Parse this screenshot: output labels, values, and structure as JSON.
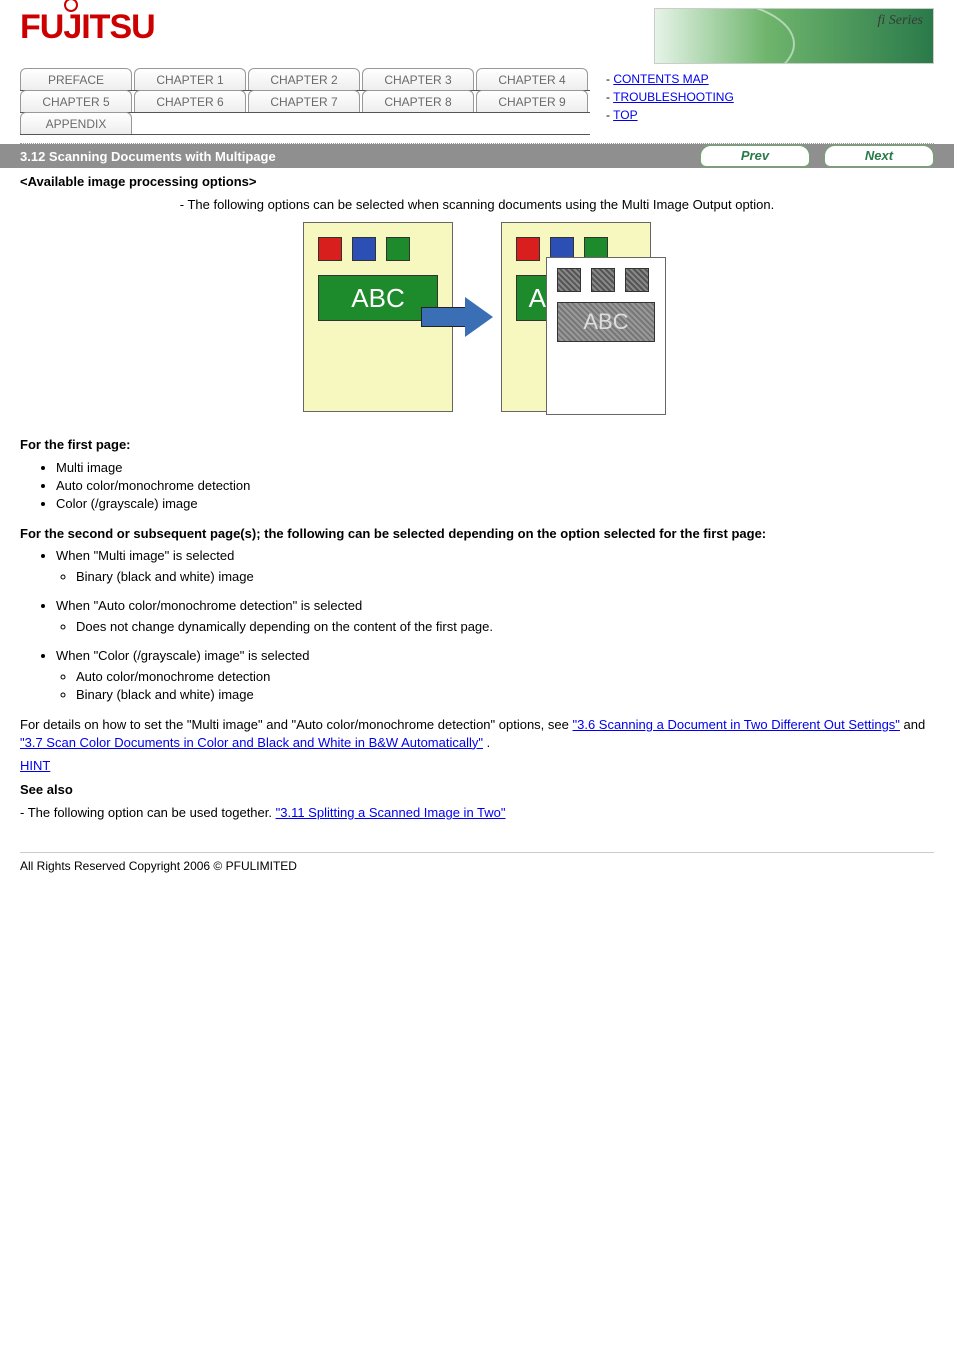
{
  "header": {
    "logo_alt": "FUJITSU",
    "banner_label": "fi Series"
  },
  "nav": {
    "rows": [
      [
        "PREFACE",
        "CHAPTER 1",
        "CHAPTER 2",
        "CHAPTER 3",
        "CHAPTER 4"
      ],
      [
        "CHAPTER 5",
        "CHAPTER 6",
        "CHAPTER 7",
        "CHAPTER 8",
        "CHAPTER 9"
      ],
      [
        "APPENDIX"
      ]
    ],
    "side_links": [
      "CONTENTS MAP",
      "TROUBLESHOOTING",
      "TOP"
    ]
  },
  "greybar": {
    "section_title": "3.12 Scanning Documents with Multipage",
    "prev_label": "Prev",
    "next_label": "Next"
  },
  "content": {
    "subtitle": "<Available image processing options>",
    "figure_caption": "- The following options can be selected when scanning documents using the Multi Image Output option.",
    "abc_label": "ABC",
    "first_group_title": "For the first page:",
    "first_group_items": [
      "Multi image",
      "Auto color/monochrome detection",
      "Color (/grayscale) image"
    ],
    "second_group_title": "For the second or subsequent page(s); the following can be selected depending on the option selected for the first page:",
    "second_group": [
      {
        "when": "When \"Multi image\" is selected",
        "items": [
          "Binary (black and white) image"
        ]
      },
      {
        "when": "When \"Auto color/monochrome detection\" is selected",
        "items": [
          "Does not change dynamically depending on the content of the first page."
        ]
      },
      {
        "when": "When \"Color (/grayscale) image\" is selected",
        "items": [
          "Auto color/monochrome detection",
          "Binary (black and white) image"
        ]
      }
    ],
    "link_label_1": "\"3.6 Scanning a Document in Two Different Out Settings\"",
    "link_label_2": "\"3.7 Scan Color Documents in Color and Black and White in B&W Automatically\"",
    "hint_para_1": "For details on how to set the \"Multi image\" and \"Auto color/monochrome detection\" options, see ",
    "hint_para_1_tail": ".",
    "hint_text": "HINT",
    "hint_para_2": " and ",
    "see_also_label": "See also",
    "see_also_link": "\"3.11 Splitting a Scanned Image in Two\""
  },
  "footer": {
    "copyright": "All Rights Reserved Copyright 2006 © PFULIMITED"
  }
}
